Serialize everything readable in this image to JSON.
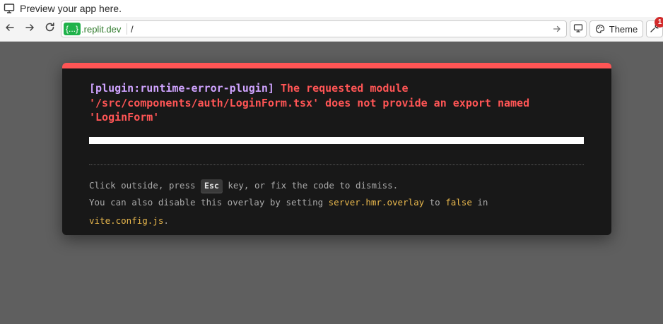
{
  "preview_header": {
    "icon": "monitor-icon",
    "text": "Preview your app here."
  },
  "toolbar": {
    "back_icon": "arrow-left-icon",
    "forward_icon": "arrow-right-icon",
    "reload_icon": "reload-icon",
    "domain_sub": "{...}",
    "domain_host": ".replit.dev",
    "path_value": "/",
    "go_icon": "arrow-right-icon",
    "devices_icon": "monitor-icon",
    "theme_icon": "palette-icon",
    "theme_label": "Theme",
    "devtools_icon": "wrench-icon",
    "devtools_badge": "1"
  },
  "overlay": {
    "plugin": "[plugin:runtime-error-plugin]",
    "message": " The requested module\n'/src/components/auth/LoginForm.tsx' does not provide an export named\n'LoginForm'",
    "tip_line1_a": "Click outside, press ",
    "tip_key": "Esc",
    "tip_line1_b": " key, or fix the code to dismiss.",
    "tip_line2_a": "You can also disable this overlay by setting ",
    "tip_code1": "server.hmr.overlay",
    "tip_line2_b": " to ",
    "tip_code2": "false",
    "tip_line2_c": " in",
    "tip_code3": "vite.config.js",
    "tip_line3_end": "."
  },
  "colors": {
    "overlay_accent": "#ff5555",
    "plugin_text": "#cfa3ff",
    "code_text": "#e9b84d",
    "domain_chip": "#1fb24a",
    "badge": "#d22b2b",
    "backdrop": "#5f5f5f"
  }
}
